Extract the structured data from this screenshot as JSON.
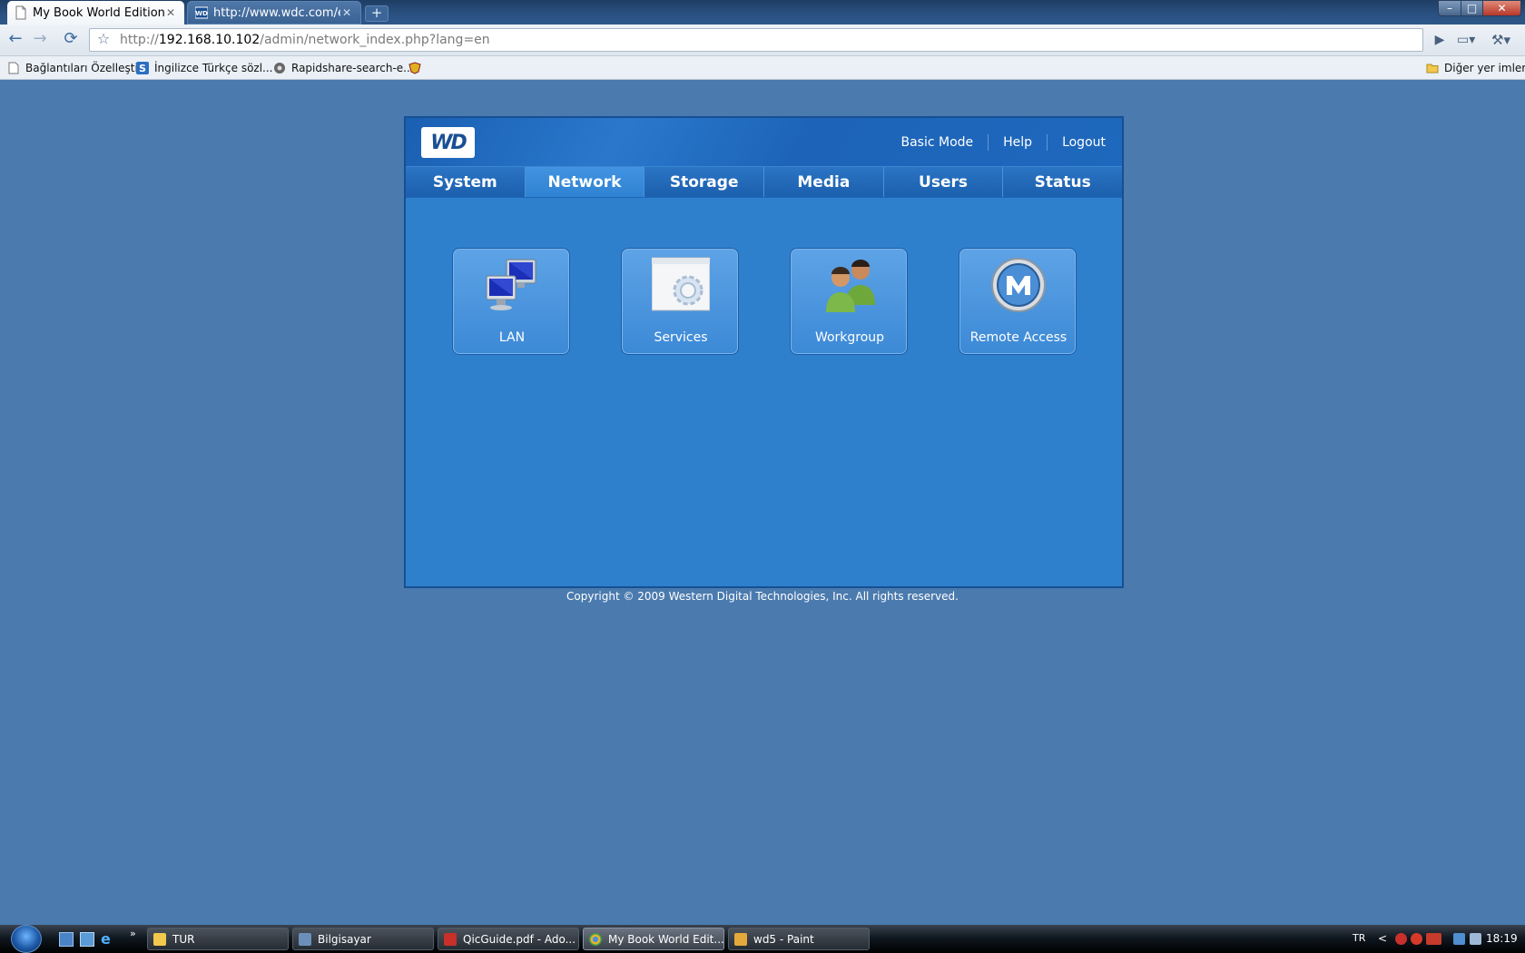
{
  "browser": {
    "tabs": [
      {
        "title": "My Book World Edition - ...",
        "active": true,
        "icon": "page-icon"
      },
      {
        "title": "http://www.wdc.com/en...",
        "active": false,
        "icon": "wd-favicon"
      }
    ],
    "new_tab_glyph": "+",
    "window_controls": {
      "minimize": "–",
      "maximize": "□",
      "close": "✕"
    },
    "nav": {
      "back": "←",
      "forward": "→",
      "reload": "⟳",
      "star": "☆"
    },
    "address": {
      "prefix": "http://",
      "host": "192.168.10.102",
      "path": "/admin/network_index.php?lang=en"
    },
    "go": "▶",
    "page_menu": "▭▾",
    "wrench_menu": "⚒▾",
    "bookmarks": [
      {
        "label": "Bağlantıları Özelleştir",
        "icon": "page-icon"
      },
      {
        "label": "İngilizce Türkçe sözl...",
        "icon": "s-icon"
      },
      {
        "label": "Rapidshare-search-e...",
        "icon": "gear-icon"
      },
      {
        "label": "",
        "icon": "bookmark-icon"
      }
    ],
    "other_bookmarks": "Diğer yer imleri"
  },
  "app": {
    "logo": "WD",
    "top_links": [
      "Basic Mode",
      "Help",
      "Logout"
    ],
    "nav_tabs": [
      "System",
      "Network",
      "Storage",
      "Media",
      "Users",
      "Status"
    ],
    "active_tab": "Network",
    "tiles": [
      {
        "label": "LAN",
        "icon": "lan-computers-icon"
      },
      {
        "label": "Services",
        "icon": "services-gear-icon"
      },
      {
        "label": "Workgroup",
        "icon": "workgroup-people-icon"
      },
      {
        "label": "Remote Access",
        "icon": "remote-access-m-icon"
      }
    ],
    "copyright": "Copyright © 2009 Western Digital Technologies, Inc. All rights reserved.",
    "colors": {
      "page_bg": "#4a7aae",
      "panel_bg": "#2f80cc",
      "header_bg": "#1d64b8",
      "active_tab": "#3a8bda"
    }
  },
  "taskbar": {
    "tasks": [
      "TUR",
      "Bilgisayar",
      "QicGuide.pdf - Ado...",
      "My Book World Edit...",
      "wd5 - Paint"
    ],
    "quicklaunch_more": "»",
    "tray": {
      "language": "TR",
      "expand": "<",
      "time": "18:19"
    }
  }
}
